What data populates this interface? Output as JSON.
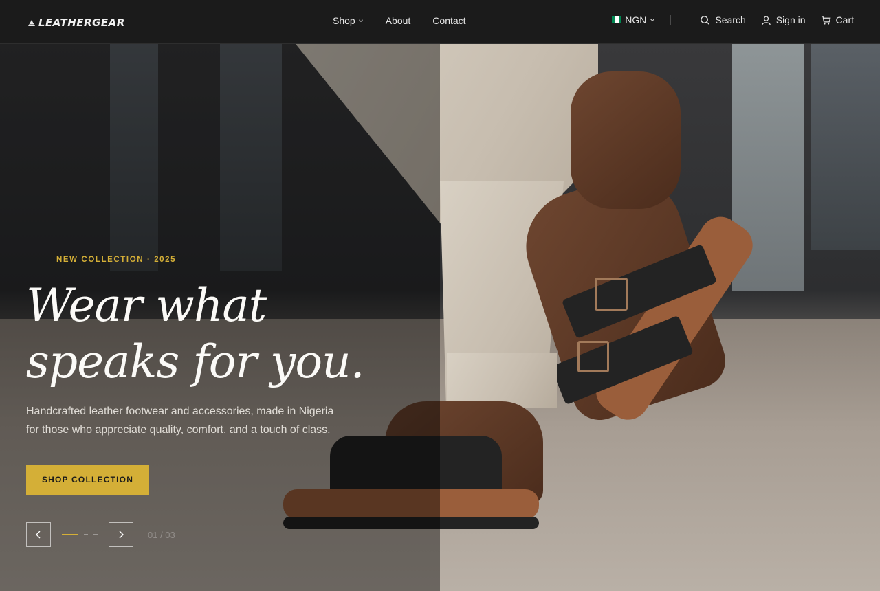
{
  "brand": {
    "name": "LEATHERGEAR"
  },
  "nav": {
    "shop": "Shop",
    "about": "About",
    "contact": "Contact"
  },
  "utility": {
    "currency": "NGN",
    "search": "Search",
    "sign_in": "Sign in",
    "cart": "Cart"
  },
  "hero": {
    "eyebrow": "NEW COLLECTION · 2025",
    "headline_line1": "Wear what",
    "headline_line2": "speaks for you.",
    "description": "Handcrafted leather footwear and accessories, made in Nigeria for those who appreciate quality, comfort, and a touch of class.",
    "cta_label": "SHOP COLLECTION",
    "secondary_label": "",
    "slide_counter": "01 / 03"
  },
  "colors": {
    "accent": "#d4af37",
    "header_bg": "#1b1b1b",
    "flag_green": "#008751",
    "flag_white": "#ffffff"
  },
  "icons": {
    "logo": "stitch-mark-icon",
    "search": "search-icon",
    "user": "user-icon",
    "cart": "cart-icon",
    "prev": "chevron-left-icon",
    "next": "chevron-right-icon",
    "dropdown": "chevron-down-icon",
    "flag": "nigeria-flag-icon"
  }
}
